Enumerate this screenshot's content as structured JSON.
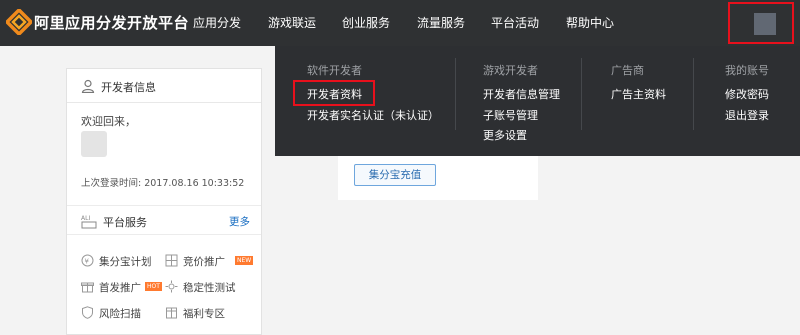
{
  "header": {
    "logo_text": "阿里应用分发开放平台",
    "nav": [
      "应用分发",
      "游戏联运",
      "创业服务",
      "流量服务",
      "平台活动",
      "帮助中心"
    ],
    "brand_color": "#f08a1c",
    "highlight_color": "#e8101c"
  },
  "dropdown": {
    "columns": [
      {
        "title": "软件开发者",
        "links": [
          "开发者资料",
          "开发者实名认证（未认证）"
        ]
      },
      {
        "title": "游戏开发者",
        "links": [
          "开发者信息管理",
          "子账号管理",
          "更多设置"
        ]
      },
      {
        "title": "广告商",
        "links": [
          "广告主资料"
        ]
      },
      {
        "title": "我的账号",
        "links": [
          "修改密码",
          "退出登录"
        ]
      }
    ]
  },
  "developer_card": {
    "title": "开发者信息",
    "welcome": "欢迎回来，",
    "last_login": "上次登录时间: 2017.08.16 10:33:52"
  },
  "platform": {
    "title": "平台服务",
    "more": "更多",
    "services": [
      {
        "label": "集分宝计划",
        "icon": "yen-icon"
      },
      {
        "label": "竞价推广",
        "icon": "grid-icon",
        "badge": "NEW"
      },
      {
        "label": "首发推广",
        "icon": "gift-icon",
        "badge": "HOT"
      },
      {
        "label": "稳定性测试",
        "icon": "gear-icon"
      },
      {
        "label": "风险扫描",
        "icon": "shield-icon"
      },
      {
        "label": "福利专区",
        "icon": "box-icon"
      }
    ]
  },
  "center": {
    "recharge_button": "集分宝充值"
  }
}
